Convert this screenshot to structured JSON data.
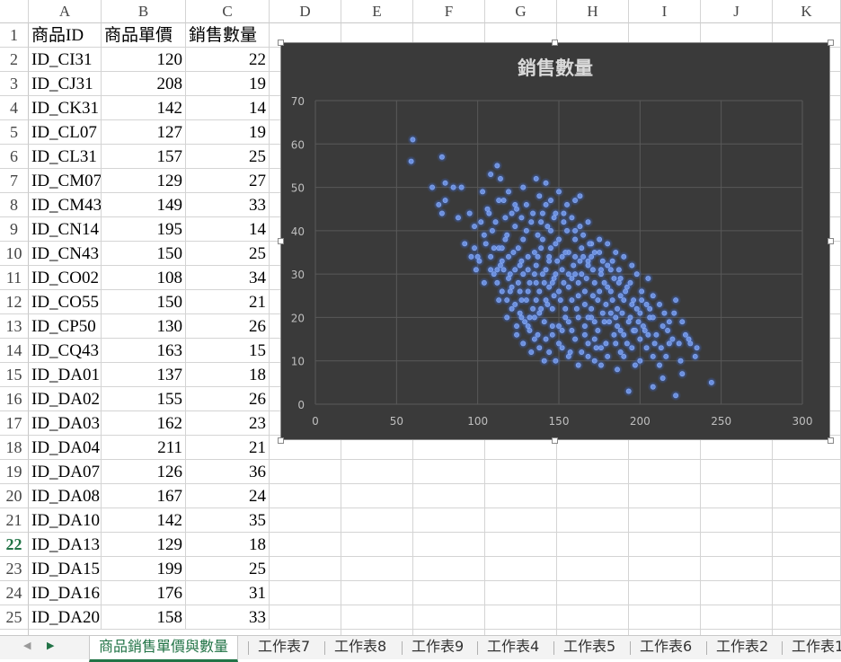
{
  "columns": [
    "A",
    "B",
    "C",
    "D",
    "E",
    "F",
    "G",
    "H",
    "I",
    "J",
    "K"
  ],
  "selected_row": 22,
  "rows": [
    {
      "n": "1",
      "a": "商品ID",
      "b": "商品單價",
      "c": "銷售數量"
    },
    {
      "n": "2",
      "a": "ID_CI31",
      "b": "120",
      "c": "22"
    },
    {
      "n": "3",
      "a": "ID_CJ31",
      "b": "208",
      "c": "19"
    },
    {
      "n": "4",
      "a": "ID_CK31",
      "b": "142",
      "c": "14"
    },
    {
      "n": "5",
      "a": "ID_CL07",
      "b": "127",
      "c": "19"
    },
    {
      "n": "6",
      "a": "ID_CL31",
      "b": "157",
      "c": "25"
    },
    {
      "n": "7",
      "a": "ID_CM07",
      "b": "129",
      "c": "27"
    },
    {
      "n": "8",
      "a": "ID_CM43",
      "b": "149",
      "c": "33"
    },
    {
      "n": "9",
      "a": "ID_CN14",
      "b": "195",
      "c": "14"
    },
    {
      "n": "10",
      "a": "ID_CN43",
      "b": "150",
      "c": "25"
    },
    {
      "n": "11",
      "a": "ID_CO02",
      "b": "108",
      "c": "34"
    },
    {
      "n": "12",
      "a": "ID_CO55",
      "b": "150",
      "c": "21"
    },
    {
      "n": "13",
      "a": "ID_CP50",
      "b": "130",
      "c": "26"
    },
    {
      "n": "14",
      "a": "ID_CQ43",
      "b": "163",
      "c": "15"
    },
    {
      "n": "15",
      "a": "ID_DA01",
      "b": "137",
      "c": "18"
    },
    {
      "n": "16",
      "a": "ID_DA02",
      "b": "155",
      "c": "26"
    },
    {
      "n": "17",
      "a": "ID_DA03",
      "b": "162",
      "c": "23"
    },
    {
      "n": "18",
      "a": "ID_DA04",
      "b": "211",
      "c": "21"
    },
    {
      "n": "19",
      "a": "ID_DA07",
      "b": "126",
      "c": "36"
    },
    {
      "n": "20",
      "a": "ID_DA08",
      "b": "167",
      "c": "24"
    },
    {
      "n": "21",
      "a": "ID_DA10",
      "b": "142",
      "c": "35"
    },
    {
      "n": "22",
      "a": "ID_DA13",
      "b": "129",
      "c": "18"
    },
    {
      "n": "23",
      "a": "ID_DA15",
      "b": "199",
      "c": "25"
    },
    {
      "n": "24",
      "a": "ID_DA16",
      "b": "176",
      "c": "31"
    },
    {
      "n": "25",
      "a": "ID_DA20",
      "b": "158",
      "c": "33"
    }
  ],
  "chart_data": {
    "type": "scatter",
    "title": "銷售數量",
    "xlim": [
      0,
      300
    ],
    "ylim": [
      0,
      70
    ],
    "x_ticks": [
      "0",
      "50",
      "100",
      "150",
      "200",
      "250",
      "300"
    ],
    "y_ticks": [
      "0",
      "10",
      "20",
      "30",
      "40",
      "50",
      "60",
      "70"
    ],
    "grid": true,
    "background": "#3a3a3a",
    "point_color": "#6b8fe0",
    "points": [
      [
        60,
        61
      ],
      [
        59,
        56
      ],
      [
        78,
        57
      ],
      [
        72,
        50
      ],
      [
        80,
        51
      ],
      [
        85,
        50
      ],
      [
        90,
        50
      ],
      [
        76,
        46
      ],
      [
        80,
        47
      ],
      [
        78,
        44
      ],
      [
        88,
        43
      ],
      [
        92,
        37
      ],
      [
        95,
        44
      ],
      [
        98,
        41
      ],
      [
        100,
        34
      ],
      [
        103,
        49
      ],
      [
        108,
        53
      ],
      [
        112,
        55
      ],
      [
        114,
        52
      ],
      [
        116,
        47
      ],
      [
        119,
        49
      ],
      [
        124,
        45
      ],
      [
        128,
        50
      ],
      [
        130,
        46
      ],
      [
        136,
        52
      ],
      [
        138,
        48
      ],
      [
        142,
        51
      ],
      [
        145,
        47
      ],
      [
        150,
        49
      ],
      [
        155,
        46
      ],
      [
        160,
        47
      ],
      [
        163,
        48
      ],
      [
        168,
        42
      ],
      [
        160,
        40
      ],
      [
        153,
        44
      ],
      [
        147,
        43
      ],
      [
        143,
        41
      ],
      [
        140,
        44
      ],
      [
        137,
        39
      ],
      [
        133,
        42
      ],
      [
        128,
        38
      ],
      [
        123,
        41
      ],
      [
        118,
        39
      ],
      [
        113,
        36
      ],
      [
        109,
        40
      ],
      [
        105,
        37
      ],
      [
        101,
        33
      ],
      [
        99,
        31
      ],
      [
        104,
        28
      ],
      [
        110,
        30
      ],
      [
        115,
        33
      ],
      [
        119,
        29
      ],
      [
        122,
        35
      ],
      [
        126,
        32
      ],
      [
        131,
        34
      ],
      [
        135,
        30
      ],
      [
        139,
        36
      ],
      [
        144,
        33
      ],
      [
        148,
        37
      ],
      [
        152,
        31
      ],
      [
        156,
        35
      ],
      [
        159,
        32
      ],
      [
        164,
        36
      ],
      [
        168,
        33
      ],
      [
        172,
        35
      ],
      [
        176,
        31
      ],
      [
        180,
        37
      ],
      [
        183,
        33
      ],
      [
        187,
        31
      ],
      [
        190,
        34
      ],
      [
        194,
        28
      ],
      [
        198,
        30
      ],
      [
        201,
        26
      ],
      [
        205,
        29
      ],
      [
        208,
        25
      ],
      [
        212,
        23
      ],
      [
        215,
        21
      ],
      [
        218,
        19
      ],
      [
        222,
        24
      ],
      [
        226,
        19
      ],
      [
        228,
        16
      ],
      [
        231,
        14
      ],
      [
        234,
        11
      ],
      [
        235,
        13
      ],
      [
        224,
        14
      ],
      [
        220,
        15
      ],
      [
        216,
        11
      ],
      [
        212,
        9
      ],
      [
        208,
        11
      ],
      [
        204,
        13
      ],
      [
        200,
        15
      ],
      [
        196,
        17
      ],
      [
        192,
        14
      ],
      [
        188,
        12
      ],
      [
        184,
        16
      ],
      [
        180,
        11
      ],
      [
        176,
        13
      ],
      [
        172,
        10
      ],
      [
        168,
        14
      ],
      [
        164,
        12
      ],
      [
        160,
        15
      ],
      [
        156,
        11
      ],
      [
        152,
        13
      ],
      [
        148,
        10
      ],
      [
        144,
        12
      ],
      [
        141,
        10
      ],
      [
        138,
        13
      ],
      [
        135,
        15
      ],
      [
        132,
        17
      ],
      [
        129,
        19
      ],
      [
        126,
        21
      ],
      [
        124,
        18
      ],
      [
        121,
        22
      ],
      [
        118,
        24
      ],
      [
        115,
        26
      ],
      [
        112,
        28
      ],
      [
        120,
        26
      ],
      [
        125,
        28
      ],
      [
        130,
        24
      ],
      [
        134,
        22
      ],
      [
        138,
        26
      ],
      [
        142,
        24
      ],
      [
        146,
        28
      ],
      [
        150,
        26
      ],
      [
        154,
        22
      ],
      [
        158,
        24
      ],
      [
        162,
        28
      ],
      [
        166,
        26
      ],
      [
        170,
        22
      ],
      [
        174,
        24
      ],
      [
        178,
        28
      ],
      [
        182,
        26
      ],
      [
        186,
        22
      ],
      [
        190,
        24
      ],
      [
        194,
        20
      ],
      [
        198,
        22
      ],
      [
        202,
        18
      ],
      [
        206,
        20
      ],
      [
        210,
        16
      ],
      [
        214,
        18
      ],
      [
        218,
        14
      ],
      [
        146,
        22
      ],
      [
        150,
        18
      ],
      [
        154,
        20
      ],
      [
        158,
        17
      ],
      [
        162,
        20
      ],
      [
        166,
        18
      ],
      [
        170,
        20
      ],
      [
        174,
        17
      ],
      [
        178,
        19
      ],
      [
        182,
        21
      ],
      [
        186,
        18
      ],
      [
        190,
        16
      ],
      [
        128,
        30
      ],
      [
        132,
        28
      ],
      [
        136,
        32
      ],
      [
        140,
        30
      ],
      [
        144,
        34
      ],
      [
        148,
        30
      ],
      [
        152,
        34
      ],
      [
        156,
        30
      ],
      [
        160,
        34
      ],
      [
        164,
        30
      ],
      [
        168,
        32
      ],
      [
        172,
        28
      ],
      [
        176,
        30
      ],
      [
        180,
        27
      ],
      [
        184,
        29
      ],
      [
        188,
        25
      ],
      [
        192,
        27
      ],
      [
        196,
        24
      ],
      [
        200,
        21
      ],
      [
        204,
        23
      ],
      [
        140,
        38
      ],
      [
        145,
        40
      ],
      [
        150,
        38
      ],
      [
        155,
        40
      ],
      [
        160,
        38
      ],
      [
        165,
        39
      ],
      [
        170,
        37
      ],
      [
        175,
        38
      ],
      [
        135,
        35
      ],
      [
        125,
        36
      ],
      [
        117,
        38
      ],
      [
        108,
        34
      ],
      [
        111,
        42
      ],
      [
        106,
        45
      ],
      [
        117,
        43
      ],
      [
        123,
        46
      ],
      [
        130,
        40
      ],
      [
        142,
        46
      ],
      [
        158,
        43
      ],
      [
        163,
        41
      ],
      [
        169,
        37
      ],
      [
        180,
        32
      ],
      [
        185,
        35
      ],
      [
        195,
        32
      ],
      [
        244,
        5
      ],
      [
        222,
        2
      ],
      [
        208,
        4
      ],
      [
        193,
        3
      ],
      [
        214,
        6
      ],
      [
        225,
        10
      ],
      [
        230,
        15
      ],
      [
        226,
        7
      ],
      [
        186,
        8
      ],
      [
        176,
        9
      ],
      [
        197,
        9
      ],
      [
        188,
        17
      ],
      [
        203,
        17
      ],
      [
        209,
        14
      ],
      [
        200,
        10
      ],
      [
        172,
        15
      ],
      [
        166,
        16
      ],
      [
        162,
        25
      ],
      [
        144,
        27
      ],
      [
        138,
        21
      ],
      [
        132,
        20
      ],
      [
        127,
        24
      ],
      [
        121,
        27
      ],
      [
        116,
        31
      ],
      [
        113,
        24
      ],
      [
        118,
        20
      ],
      [
        124,
        16
      ],
      [
        128,
        14
      ],
      [
        133,
        12
      ],
      [
        137,
        16
      ],
      [
        142,
        15
      ],
      [
        146,
        18
      ],
      [
        152,
        17
      ],
      [
        156,
        19
      ],
      [
        161,
        22
      ],
      [
        166,
        23
      ],
      [
        171,
        25
      ],
      [
        175,
        26
      ],
      [
        179,
        23
      ],
      [
        183,
        24
      ],
      [
        187,
        28
      ],
      [
        191,
        26
      ],
      [
        195,
        23
      ],
      [
        199,
        19
      ],
      [
        205,
        16
      ],
      [
        208,
        20
      ],
      [
        213,
        13
      ],
      [
        217,
        17
      ],
      [
        221,
        21
      ],
      [
        195,
        13
      ],
      [
        190,
        11
      ],
      [
        185,
        14
      ],
      [
        179,
        14
      ],
      [
        173,
        13
      ],
      [
        168,
        11
      ],
      [
        162,
        9
      ],
      [
        157,
        12
      ],
      [
        150,
        14
      ],
      [
        146,
        16
      ],
      [
        141,
        19
      ],
      [
        136,
        24
      ],
      [
        131,
        26
      ],
      [
        126,
        26
      ],
      [
        120,
        30
      ],
      [
        114,
        32
      ],
      [
        110,
        36
      ],
      [
        104,
        39
      ],
      [
        98,
        36
      ],
      [
        96,
        34
      ],
      [
        102,
        42
      ],
      [
        107,
        44
      ],
      [
        113,
        47
      ],
      [
        121,
        44
      ],
      [
        127,
        43
      ],
      [
        134,
        44
      ],
      [
        139,
        42
      ],
      [
        148,
        44
      ],
      [
        153,
        42
      ],
      [
        137,
        34
      ],
      [
        142,
        31
      ],
      [
        147,
        29
      ],
      [
        153,
        28
      ],
      [
        158,
        29
      ],
      [
        163,
        33
      ],
      [
        167,
        29
      ],
      [
        171,
        31
      ],
      [
        177,
        33
      ],
      [
        182,
        31
      ],
      [
        188,
        29
      ],
      [
        154,
        35
      ],
      [
        149,
        33
      ],
      [
        145,
        36
      ],
      [
        141,
        28
      ],
      [
        136,
        28
      ],
      [
        131,
        31
      ],
      [
        127,
        33
      ],
      [
        123,
        31
      ],
      [
        119,
        34
      ],
      [
        115,
        36
      ],
      [
        112,
        31
      ],
      [
        108,
        31
      ],
      [
        165,
        34
      ],
      [
        170,
        34
      ],
      [
        175,
        35
      ],
      [
        160,
        30
      ],
      [
        156,
        27
      ],
      [
        151,
        24
      ],
      [
        147,
        25
      ],
      [
        143,
        23
      ],
      [
        139,
        22
      ],
      [
        135,
        20
      ],
      [
        131,
        18
      ],
      [
        127,
        20
      ],
      [
        123,
        23
      ],
      [
        168,
        20
      ],
      [
        172,
        19
      ],
      [
        177,
        21
      ],
      [
        181,
        19
      ],
      [
        185,
        20
      ],
      [
        189,
        21
      ],
      [
        193,
        19
      ],
      [
        197,
        17
      ],
      [
        201,
        24
      ],
      [
        206,
        22
      ]
    ]
  },
  "tabs": [
    "商品銷售單價與數量",
    "工作表7",
    "工作表8",
    "工作表9",
    "工作表4",
    "工作表5",
    "工作表6",
    "工作表2",
    "工作表1"
  ],
  "active_tab": 0
}
